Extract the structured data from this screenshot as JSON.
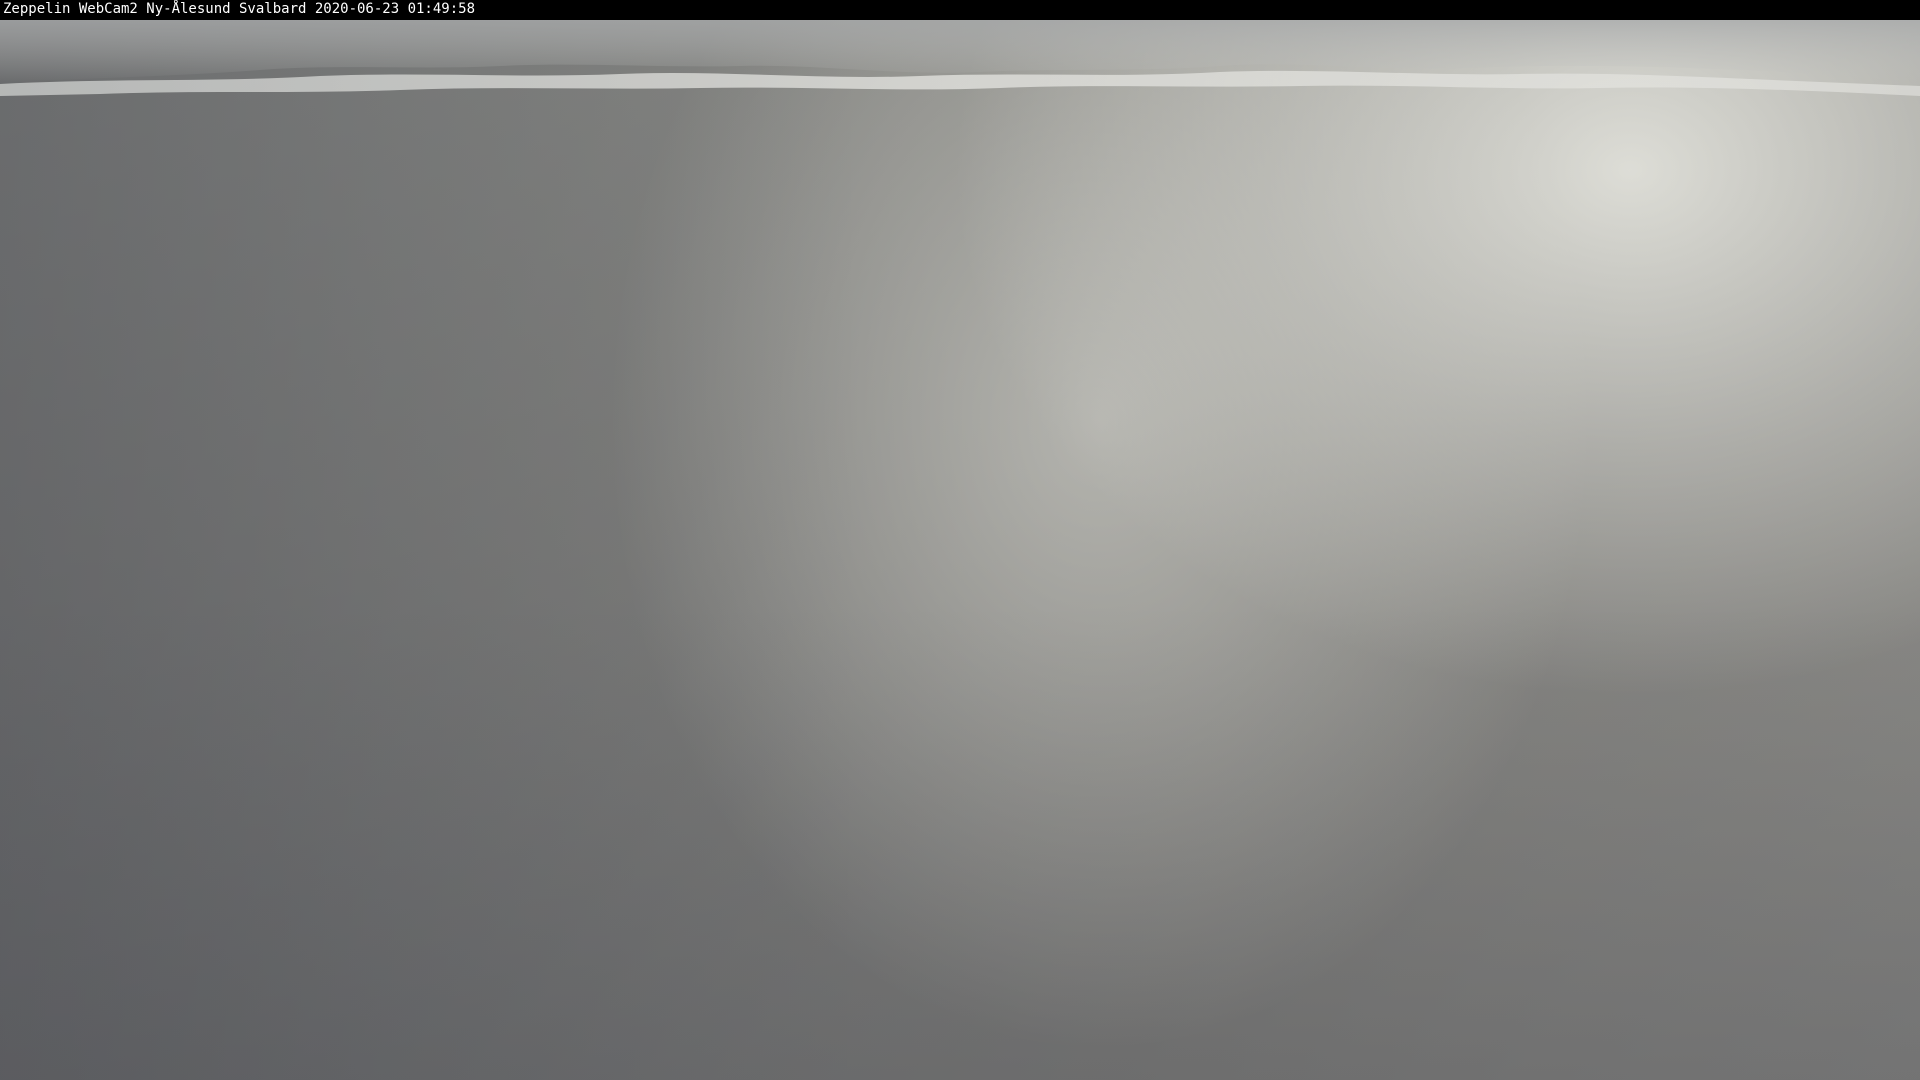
{
  "overlay": {
    "caption": "Zeppelin WebCam2 Ny-Ålesund Svalbard 2020-06-23 01:49:58"
  },
  "colors": {
    "caption_background": "#000000",
    "caption_text": "#ffffff",
    "fog": "#b4b4b2"
  }
}
